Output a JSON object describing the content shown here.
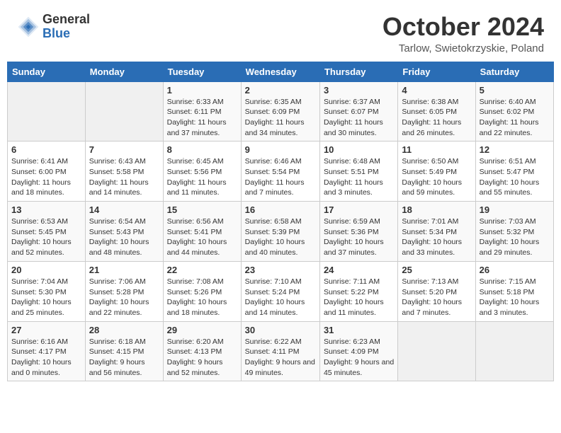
{
  "header": {
    "logo_general": "General",
    "logo_blue": "Blue",
    "month_title": "October 2024",
    "subtitle": "Tarlow, Swietokrzyskie, Poland"
  },
  "weekdays": [
    "Sunday",
    "Monday",
    "Tuesday",
    "Wednesday",
    "Thursday",
    "Friday",
    "Saturday"
  ],
  "weeks": [
    [
      {
        "day": "",
        "info": ""
      },
      {
        "day": "",
        "info": ""
      },
      {
        "day": "1",
        "info": "Sunrise: 6:33 AM\nSunset: 6:11 PM\nDaylight: 11 hours and 37 minutes."
      },
      {
        "day": "2",
        "info": "Sunrise: 6:35 AM\nSunset: 6:09 PM\nDaylight: 11 hours and 34 minutes."
      },
      {
        "day": "3",
        "info": "Sunrise: 6:37 AM\nSunset: 6:07 PM\nDaylight: 11 hours and 30 minutes."
      },
      {
        "day": "4",
        "info": "Sunrise: 6:38 AM\nSunset: 6:05 PM\nDaylight: 11 hours and 26 minutes."
      },
      {
        "day": "5",
        "info": "Sunrise: 6:40 AM\nSunset: 6:02 PM\nDaylight: 11 hours and 22 minutes."
      }
    ],
    [
      {
        "day": "6",
        "info": "Sunrise: 6:41 AM\nSunset: 6:00 PM\nDaylight: 11 hours and 18 minutes."
      },
      {
        "day": "7",
        "info": "Sunrise: 6:43 AM\nSunset: 5:58 PM\nDaylight: 11 hours and 14 minutes."
      },
      {
        "day": "8",
        "info": "Sunrise: 6:45 AM\nSunset: 5:56 PM\nDaylight: 11 hours and 11 minutes."
      },
      {
        "day": "9",
        "info": "Sunrise: 6:46 AM\nSunset: 5:54 PM\nDaylight: 11 hours and 7 minutes."
      },
      {
        "day": "10",
        "info": "Sunrise: 6:48 AM\nSunset: 5:51 PM\nDaylight: 11 hours and 3 minutes."
      },
      {
        "day": "11",
        "info": "Sunrise: 6:50 AM\nSunset: 5:49 PM\nDaylight: 10 hours and 59 minutes."
      },
      {
        "day": "12",
        "info": "Sunrise: 6:51 AM\nSunset: 5:47 PM\nDaylight: 10 hours and 55 minutes."
      }
    ],
    [
      {
        "day": "13",
        "info": "Sunrise: 6:53 AM\nSunset: 5:45 PM\nDaylight: 10 hours and 52 minutes."
      },
      {
        "day": "14",
        "info": "Sunrise: 6:54 AM\nSunset: 5:43 PM\nDaylight: 10 hours and 48 minutes."
      },
      {
        "day": "15",
        "info": "Sunrise: 6:56 AM\nSunset: 5:41 PM\nDaylight: 10 hours and 44 minutes."
      },
      {
        "day": "16",
        "info": "Sunrise: 6:58 AM\nSunset: 5:39 PM\nDaylight: 10 hours and 40 minutes."
      },
      {
        "day": "17",
        "info": "Sunrise: 6:59 AM\nSunset: 5:36 PM\nDaylight: 10 hours and 37 minutes."
      },
      {
        "day": "18",
        "info": "Sunrise: 7:01 AM\nSunset: 5:34 PM\nDaylight: 10 hours and 33 minutes."
      },
      {
        "day": "19",
        "info": "Sunrise: 7:03 AM\nSunset: 5:32 PM\nDaylight: 10 hours and 29 minutes."
      }
    ],
    [
      {
        "day": "20",
        "info": "Sunrise: 7:04 AM\nSunset: 5:30 PM\nDaylight: 10 hours and 25 minutes."
      },
      {
        "day": "21",
        "info": "Sunrise: 7:06 AM\nSunset: 5:28 PM\nDaylight: 10 hours and 22 minutes."
      },
      {
        "day": "22",
        "info": "Sunrise: 7:08 AM\nSunset: 5:26 PM\nDaylight: 10 hours and 18 minutes."
      },
      {
        "day": "23",
        "info": "Sunrise: 7:10 AM\nSunset: 5:24 PM\nDaylight: 10 hours and 14 minutes."
      },
      {
        "day": "24",
        "info": "Sunrise: 7:11 AM\nSunset: 5:22 PM\nDaylight: 10 hours and 11 minutes."
      },
      {
        "day": "25",
        "info": "Sunrise: 7:13 AM\nSunset: 5:20 PM\nDaylight: 10 hours and 7 minutes."
      },
      {
        "day": "26",
        "info": "Sunrise: 7:15 AM\nSunset: 5:18 PM\nDaylight: 10 hours and 3 minutes."
      }
    ],
    [
      {
        "day": "27",
        "info": "Sunrise: 6:16 AM\nSunset: 4:17 PM\nDaylight: 10 hours and 0 minutes."
      },
      {
        "day": "28",
        "info": "Sunrise: 6:18 AM\nSunset: 4:15 PM\nDaylight: 9 hours and 56 minutes."
      },
      {
        "day": "29",
        "info": "Sunrise: 6:20 AM\nSunset: 4:13 PM\nDaylight: 9 hours and 52 minutes."
      },
      {
        "day": "30",
        "info": "Sunrise: 6:22 AM\nSunset: 4:11 PM\nDaylight: 9 hours and 49 minutes."
      },
      {
        "day": "31",
        "info": "Sunrise: 6:23 AM\nSunset: 4:09 PM\nDaylight: 9 hours and 45 minutes."
      },
      {
        "day": "",
        "info": ""
      },
      {
        "day": "",
        "info": ""
      }
    ]
  ]
}
